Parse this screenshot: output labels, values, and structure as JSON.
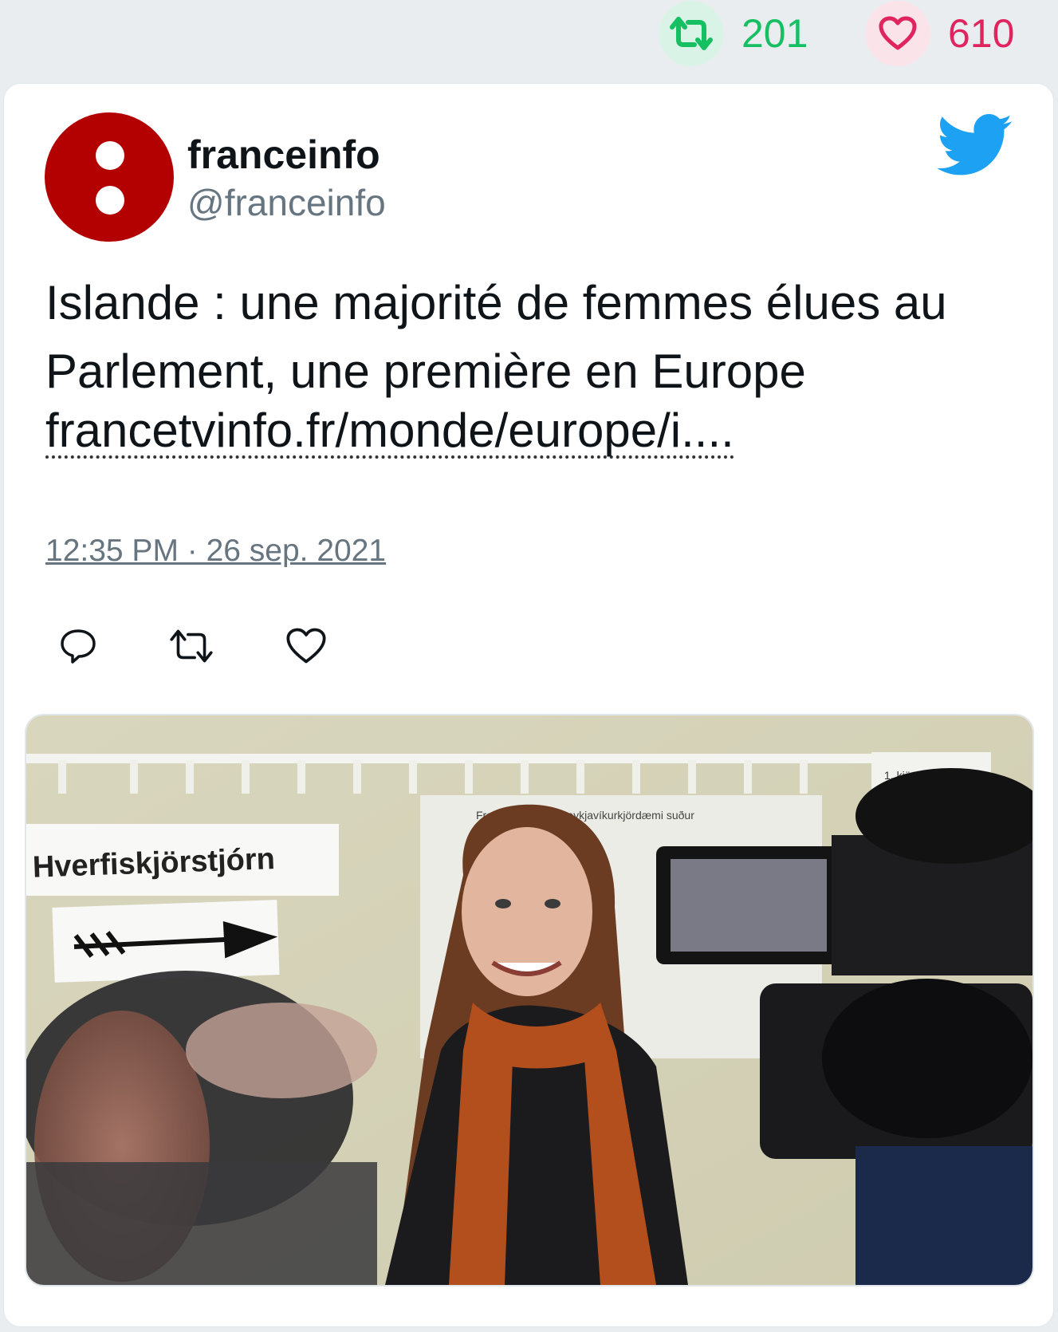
{
  "stats": {
    "retweets": "201",
    "likes": "610"
  },
  "author": {
    "display_name": "franceinfo",
    "handle": "@franceinfo"
  },
  "tweet": {
    "text": "Islande : une majorité de femmes élues au Parlement, une première en Europe",
    "link": "francetvinfo.fr/monde/europe/i....",
    "timestamp": "12:35 PM · 26 sep. 2021"
  },
  "photo": {
    "sign_text": "Hverfiskjörstjórn",
    "poster_text": "Framboðslistar í Reykjavíkurkjördæmi suður",
    "corner_text": "1. kjördeild"
  },
  "icons": {
    "retweet": "retweet-icon",
    "like": "heart-icon",
    "reply": "reply-icon",
    "twitter": "twitter-bird-icon"
  },
  "colors": {
    "retweet_green": "#17bf63",
    "like_red": "#e0245e",
    "twitter_blue": "#1da1f2",
    "avatar_red": "#b30000"
  }
}
